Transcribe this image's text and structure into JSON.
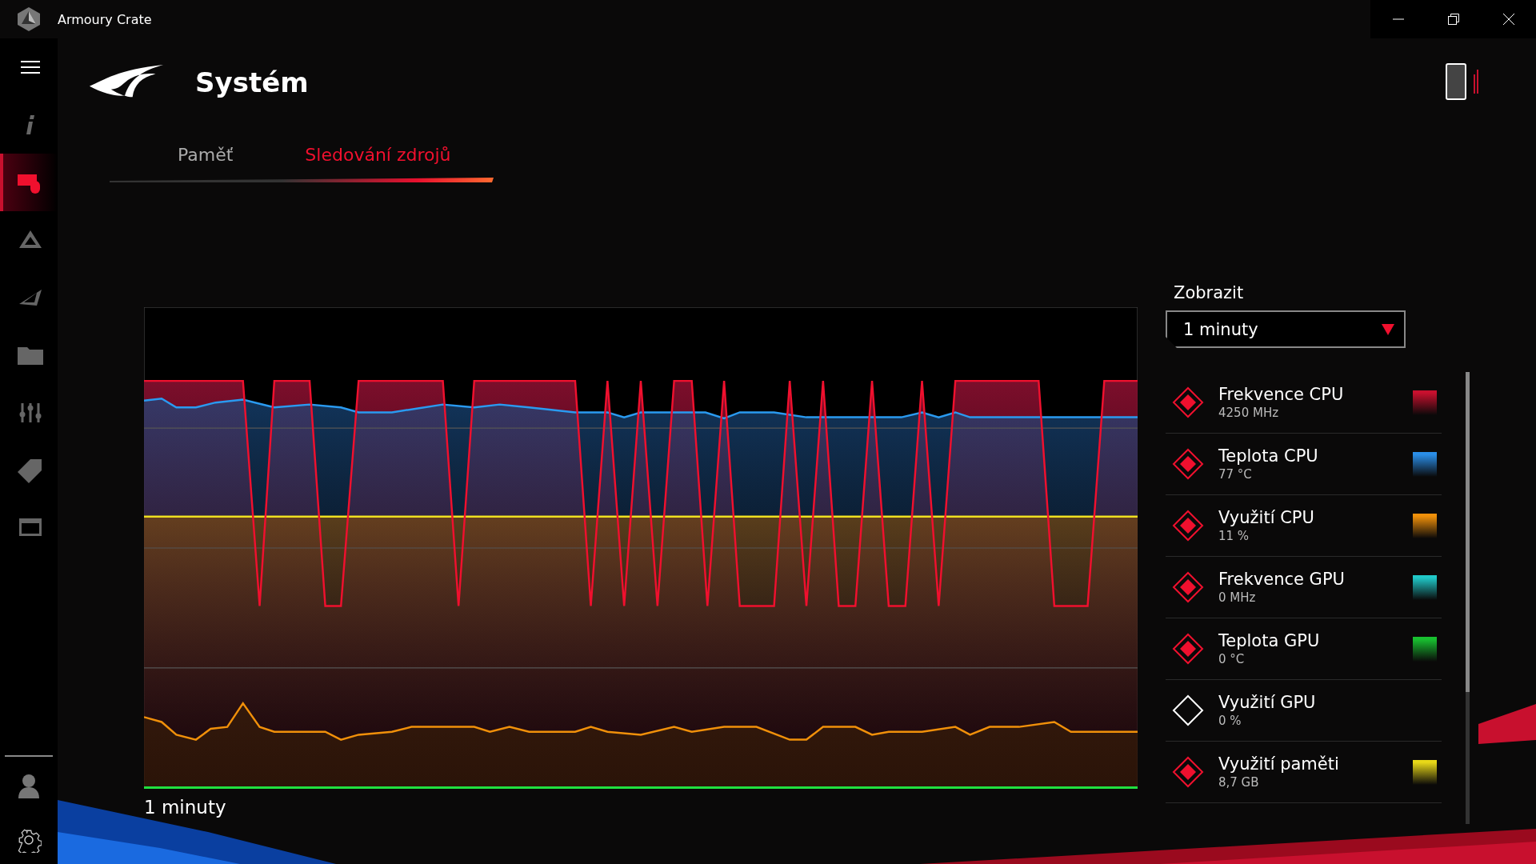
{
  "window": {
    "title": "Armoury Crate"
  },
  "sidebar": {
    "items": [
      {
        "selected": false
      },
      {
        "selected": true
      },
      {
        "selected": false
      },
      {
        "selected": false
      },
      {
        "selected": false
      },
      {
        "selected": false
      },
      {
        "selected": false
      },
      {
        "selected": false
      }
    ]
  },
  "page": {
    "title": "Systém"
  },
  "tabs": [
    {
      "label": "Paměť",
      "selected": false
    },
    {
      "label": "Sledování zdrojů",
      "selected": true
    }
  ],
  "chart": {
    "time_label": "1 minuty"
  },
  "display": {
    "label": "Zobrazit",
    "value": "1  minuty"
  },
  "metrics": [
    {
      "name": "Frekvence CPU",
      "value": "4250 MHz",
      "checked": true,
      "color": "#c8102e"
    },
    {
      "name": "Teplota CPU",
      "value": "77 °C",
      "checked": true,
      "color": "#2a8ee8"
    },
    {
      "name": "Využití CPU",
      "value": "11 %",
      "checked": true,
      "color": "#f0900a"
    },
    {
      "name": "Frekvence GPU",
      "value": "0 MHz",
      "checked": true,
      "color": "#20c8c8"
    },
    {
      "name": "Teplota GPU",
      "value": "0 °C",
      "checked": true,
      "color": "#18c030"
    },
    {
      "name": "Využití GPU",
      "value": "0 %",
      "checked": false
    },
    {
      "name": "Využití paměti",
      "value": "8,7 GB",
      "checked": true,
      "color": "#e8d818"
    }
  ]
}
